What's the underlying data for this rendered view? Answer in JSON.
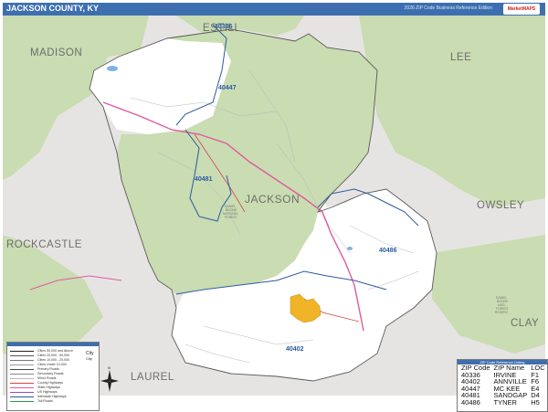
{
  "title": "JACKSON COUNTY, KY",
  "edition": "2026 ZIP Code Business Reference Edition",
  "brand": "MarketMAPS",
  "colors": {
    "header": "#3d6fb0",
    "green": "#c9dcb2",
    "white": "#ffffff",
    "outside": "#e6e4e2",
    "city": "#f0b429",
    "zipline": "#2c5aa0",
    "road": "#e05aa0"
  },
  "neighbors": {
    "madison": "MADISON",
    "estill": "ESTILL",
    "lee": "LEE",
    "owsley": "OWSLEY",
    "rockcastle": "ROCKCASTLE",
    "laurel": "LAUREL",
    "clay": "CLAY"
  },
  "county_name": "JACKSON",
  "zip_labels": {
    "z40336": "40336",
    "z40447": "40447",
    "z40481": "40481",
    "z40486": "40486",
    "z40402": "40402"
  },
  "forest_labels": {
    "daniel_boone_1": "DANIEL",
    "daniel_boone_2": "BOONE",
    "daniel_boone_3": "NATIONAL",
    "daniel_boone_4": "FOREST",
    "east_1": "DANIEL",
    "east_2": "BOONE",
    "east_3": "NATL",
    "east_4": "FOREST",
    "east_5": "RESERV"
  },
  "legend": {
    "rows": [
      {
        "label": "Cities 50,000 and Above"
      },
      {
        "label": "Cities 20,000 - 50,000"
      },
      {
        "label": "Cities 10,000 - 20,000"
      },
      {
        "label": "Cities Under 10,000"
      },
      {
        "label": "Primary Roads"
      },
      {
        "label": "Secondary Roads"
      },
      {
        "label": "Minor Roads"
      },
      {
        "label": "County Highways"
      },
      {
        "label": "State Highways"
      },
      {
        "label": "US Highways"
      },
      {
        "label": "Interstate Highways"
      },
      {
        "label": "Toll Roads"
      }
    ],
    "city_big": "City",
    "city_small": "City"
  },
  "zip_table": {
    "title": "ZIP Code Reference Listing",
    "headers": [
      "ZIP Code",
      "ZIP Name",
      "LOC"
    ],
    "rows": [
      [
        "40336",
        "IRVINE",
        "F1"
      ],
      [
        "40402",
        "ANNVILLE",
        "F6"
      ],
      [
        "40447",
        "MC KEE",
        "E4"
      ],
      [
        "40481",
        "SANDGAP",
        "D4"
      ],
      [
        "40486",
        "TYNER",
        "H5"
      ]
    ]
  },
  "compass": {
    "n": "N"
  }
}
